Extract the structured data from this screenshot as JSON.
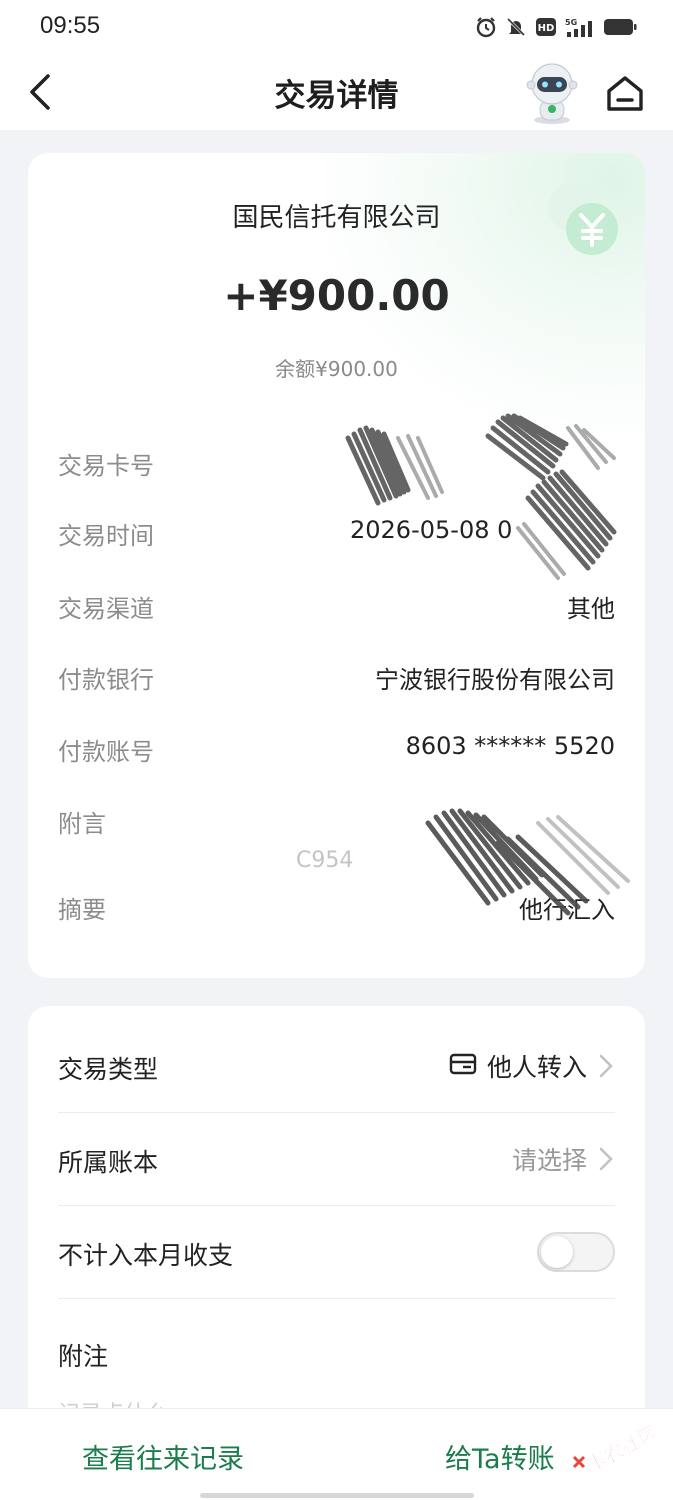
{
  "status_bar": {
    "time": "09:55"
  },
  "nav": {
    "title": "交易详情"
  },
  "transaction": {
    "payer_name": "国民信托有限公司",
    "amount": "+¥900.00",
    "balance": "余额¥900.00",
    "rows": [
      {
        "label": "交易卡号",
        "value": ""
      },
      {
        "label": "交易时间",
        "value": "2026-05-08 0"
      },
      {
        "label": "交易渠道",
        "value": "其他"
      },
      {
        "label": "付款银行",
        "value": "宁波银行股份有限公司"
      },
      {
        "label": "付款账号",
        "value": "8603 ****** 5520"
      },
      {
        "label": "附言",
        "value": "C954"
      },
      {
        "label": "摘要",
        "value": "他行汇入"
      }
    ]
  },
  "settings": {
    "type_label": "交易类型",
    "type_value": "他人转入",
    "ledger_label": "所属账本",
    "ledger_value": "请选择",
    "exclude_label": "不计入本月收支",
    "exclude_on": false,
    "note_label": "附注",
    "note_hint": "记录点什么"
  },
  "bottom": {
    "history_label": "查看往来记录",
    "transfer_label": "给Ta转账"
  },
  "watermark": "卡农社区",
  "colors": {
    "accent": "#1b7c4c",
    "badge": "#9fe0b8"
  }
}
